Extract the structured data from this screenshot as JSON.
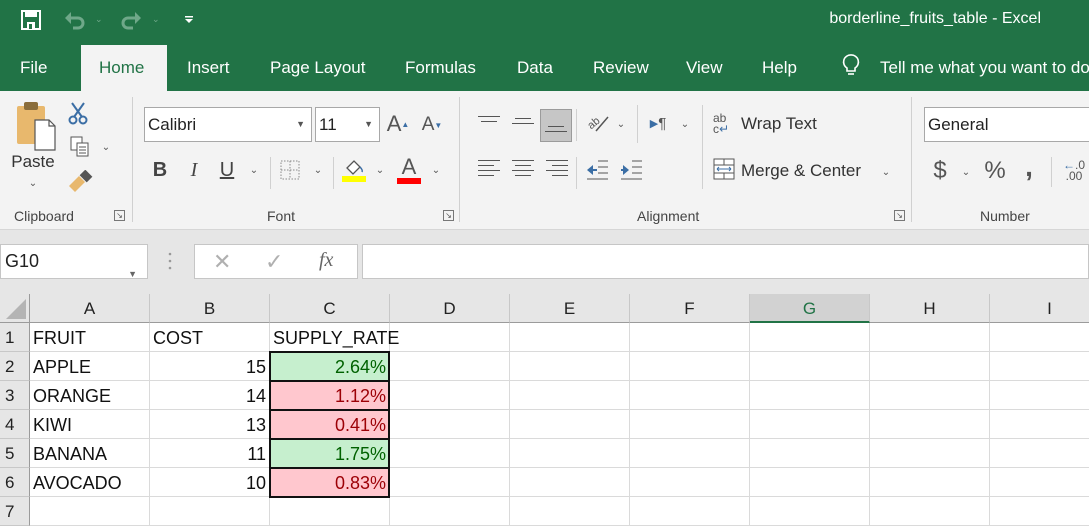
{
  "app": {
    "document_title": "borderline_fruits_table  -  Excel",
    "brand_color": "#217346"
  },
  "quick_access": {
    "save_icon": "save-icon",
    "undo_icon": "undo-icon",
    "redo_icon": "redo-icon",
    "customize_icon": "customize-qat-icon"
  },
  "tabs": [
    {
      "label": "File"
    },
    {
      "label": "Home",
      "active": true
    },
    {
      "label": "Insert"
    },
    {
      "label": "Page Layout"
    },
    {
      "label": "Formulas"
    },
    {
      "label": "Data"
    },
    {
      "label": "Review"
    },
    {
      "label": "View"
    },
    {
      "label": "Help"
    }
  ],
  "tell_me": {
    "label": "Tell me what you want to do"
  },
  "ribbon": {
    "clipboard": {
      "label": "Clipboard",
      "paste_label": "Paste"
    },
    "font": {
      "label": "Font",
      "font_name": "Calibri",
      "font_size": "11",
      "bold": "B",
      "italic": "I",
      "underline": "U",
      "fill_color": "#ffff00",
      "font_color": "#ff0000"
    },
    "alignment": {
      "label": "Alignment",
      "wrap_text": "Wrap Text",
      "merge_center": "Merge & Center"
    },
    "number": {
      "label": "Number",
      "format": "General",
      "currency": "$",
      "percent": "%",
      "comma": ",",
      "increase_decimal_top": ".0",
      "increase_decimal_bottom": ".00"
    }
  },
  "formula_bar": {
    "name_box": "G10",
    "cancel": "✕",
    "enter": "✓",
    "fx": "fx",
    "value": ""
  },
  "sheet": {
    "columns": [
      "A",
      "B",
      "C",
      "D",
      "E",
      "F",
      "G",
      "H",
      "I"
    ],
    "selected_column": "G",
    "row_numbers": [
      "1",
      "2",
      "3",
      "4",
      "5",
      "6",
      "7"
    ],
    "header": [
      "FRUIT",
      "COST",
      "SUPPLY_RATE"
    ],
    "rows": [
      {
        "fruit": "APPLE",
        "cost": "15",
        "supply_rate": "2.64%",
        "status": "good"
      },
      {
        "fruit": "ORANGE",
        "cost": "14",
        "supply_rate": "1.12%",
        "status": "bad"
      },
      {
        "fruit": "KIWI",
        "cost": "13",
        "supply_rate": "0.41%",
        "status": "bad"
      },
      {
        "fruit": "BANANA",
        "cost": "11",
        "supply_rate": "1.75%",
        "status": "good"
      },
      {
        "fruit": "AVOCADO",
        "cost": "10",
        "supply_rate": "0.83%",
        "status": "bad"
      }
    ],
    "cf_colors": {
      "good_fill": "#c6efce",
      "good_text": "#006100",
      "bad_fill": "#ffc7ce",
      "bad_text": "#9c0006"
    }
  }
}
